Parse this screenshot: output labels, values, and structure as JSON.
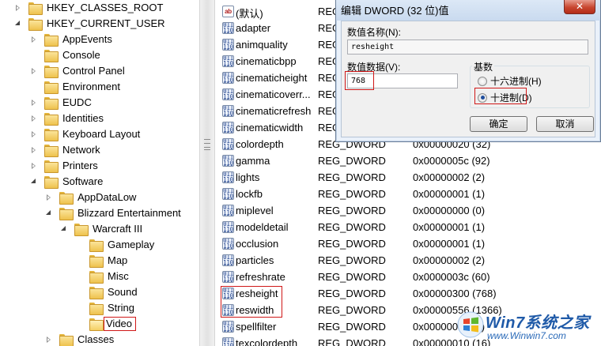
{
  "tree": {
    "items": [
      {
        "label": "HKEY_CLASSES_ROOT",
        "state": "closed"
      },
      {
        "label": "HKEY_CURRENT_USER",
        "state": "open"
      },
      {
        "label": "AppEvents",
        "state": "closed"
      },
      {
        "label": "Console",
        "state": "none"
      },
      {
        "label": "Control Panel",
        "state": "closed"
      },
      {
        "label": "Environment",
        "state": "none"
      },
      {
        "label": "EUDC",
        "state": "closed"
      },
      {
        "label": "Identities",
        "state": "closed"
      },
      {
        "label": "Keyboard Layout",
        "state": "closed"
      },
      {
        "label": "Network",
        "state": "closed"
      },
      {
        "label": "Printers",
        "state": "closed"
      },
      {
        "label": "Software",
        "state": "open"
      },
      {
        "label": "AppDataLow",
        "state": "closed"
      },
      {
        "label": "Blizzard Entertainment",
        "state": "open"
      },
      {
        "label": "Warcraft III",
        "state": "open"
      },
      {
        "label": "Gameplay",
        "state": "none"
      },
      {
        "label": "Map",
        "state": "none"
      },
      {
        "label": "Misc",
        "state": "none"
      },
      {
        "label": "Sound",
        "state": "none"
      },
      {
        "label": "String",
        "state": "none"
      },
      {
        "label": "Video",
        "state": "none",
        "selected": true
      },
      {
        "label": "Classes",
        "state": "closed"
      }
    ]
  },
  "values": {
    "rows": [
      {
        "name": "(默认)",
        "type": "REG",
        "data": "",
        "icon": "ab"
      },
      {
        "name": "adapter",
        "type": "REG",
        "data": "",
        "icon": "bin"
      },
      {
        "name": "animquality",
        "type": "REG",
        "data": "",
        "icon": "bin"
      },
      {
        "name": "cinematicbpp",
        "type": "REG",
        "data": "",
        "icon": "bin"
      },
      {
        "name": "cinematicheight",
        "type": "REG",
        "data": "",
        "icon": "bin"
      },
      {
        "name": "cinematicoverr...",
        "type": "REG",
        "data": "",
        "icon": "bin"
      },
      {
        "name": "cinematicrefresh",
        "type": "REG",
        "data": "",
        "icon": "bin"
      },
      {
        "name": "cinematicwidth",
        "type": "REG",
        "data": "",
        "icon": "bin"
      },
      {
        "name": "colordepth",
        "type": "REG_DWORD",
        "data": "0x00000020 (32)",
        "icon": "bin"
      },
      {
        "name": "gamma",
        "type": "REG_DWORD",
        "data": "0x0000005c (92)",
        "icon": "bin"
      },
      {
        "name": "lights",
        "type": "REG_DWORD",
        "data": "0x00000002 (2)",
        "icon": "bin"
      },
      {
        "name": "lockfb",
        "type": "REG_DWORD",
        "data": "0x00000001 (1)",
        "icon": "bin"
      },
      {
        "name": "miplevel",
        "type": "REG_DWORD",
        "data": "0x00000000 (0)",
        "icon": "bin"
      },
      {
        "name": "modeldetail",
        "type": "REG_DWORD",
        "data": "0x00000001 (1)",
        "icon": "bin"
      },
      {
        "name": "occlusion",
        "type": "REG_DWORD",
        "data": "0x00000001 (1)",
        "icon": "bin"
      },
      {
        "name": "particles",
        "type": "REG_DWORD",
        "data": "0x00000002 (2)",
        "icon": "bin"
      },
      {
        "name": "refreshrate",
        "type": "REG_DWORD",
        "data": "0x0000003c (60)",
        "icon": "bin"
      },
      {
        "name": "resheight",
        "type": "REG_DWORD",
        "data": "0x00000300 (768)",
        "icon": "bin"
      },
      {
        "name": "reswidth",
        "type": "REG_DWORD",
        "data": "0x00000556 (1366)",
        "icon": "bin"
      },
      {
        "name": "spellfilter",
        "type": "REG_DWORD",
        "data": "0x00000002 (2)",
        "icon": "bin"
      },
      {
        "name": "texcolordepth",
        "type": "REG_DWORD",
        "data": "0x00000010 (16)",
        "icon": "bin"
      }
    ]
  },
  "dialog": {
    "title": "编辑 DWORD (32 位)值",
    "close_label": "✕",
    "name_label": "数值名称(N):",
    "name_value": "resheight",
    "data_label": "数值数据(V):",
    "data_value": "768",
    "base_label": "基数",
    "hex_label": "十六进制(H)",
    "dec_label": "十进制(D)",
    "selected_base": "decimal",
    "ok_label": "确定",
    "cancel_label": "取消"
  },
  "icons": {
    "binary_value_icon_glyph": "011\n110\n010",
    "string_value_icon_glyph": "ab"
  },
  "watermark": {
    "brand": "Win7系统之家",
    "url": "www.Winwin7.com"
  },
  "colors": {
    "highlight_box": "#d01818",
    "folder": "#eec24d",
    "dialog_bg": "#eaf1fa",
    "radio_dot": "#1e4d9c",
    "watermark_blue": "#1f5aa8"
  }
}
